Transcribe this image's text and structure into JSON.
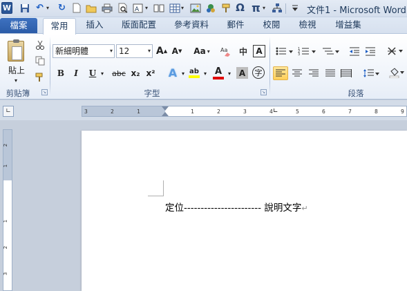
{
  "window": {
    "title": "文件1 - Microsoft Word"
  },
  "quick_access": {
    "icons": [
      "word-logo-icon",
      "save-icon",
      "undo-icon",
      "redo-icon",
      "new-document-icon",
      "open-icon",
      "print-icon",
      "print-preview-icon",
      "text-box-icon",
      "insert-page-icon",
      "table-icon",
      "picture-icon",
      "clip-art-icon",
      "format-painter-icon",
      "symbol-icon",
      "equation-icon",
      "smartart-icon",
      "customize-icon"
    ],
    "word_logo": "W",
    "symbol": "Ω",
    "equation": "π"
  },
  "tabs": [
    {
      "label": "檔案"
    },
    {
      "label": "常用"
    },
    {
      "label": "插入"
    },
    {
      "label": "版面配置"
    },
    {
      "label": "參考資料"
    },
    {
      "label": "郵件"
    },
    {
      "label": "校閱"
    },
    {
      "label": "檢視"
    },
    {
      "label": "增益集"
    }
  ],
  "ribbon": {
    "clipboard": {
      "paste_label": "貼上",
      "group_label": "剪貼簿"
    },
    "font": {
      "font_name": "新細明體",
      "font_size": "12",
      "group_label": "字型",
      "grow_label": "A",
      "shrink_label": "A",
      "case_label": "Aa",
      "bold": "B",
      "italic": "I",
      "underline": "U",
      "strike": "abc",
      "subscript": "x₂",
      "superscript": "x²",
      "text_effects": "A",
      "highlight": "ab",
      "font_color": "A",
      "char_shading": "A",
      "enclose": "字",
      "phonetic": "中",
      "border": "A"
    },
    "paragraph": {
      "group_label": "段落"
    }
  },
  "document": {
    "line_text": "定位----------------------- 說明文字",
    "para_mark": "↵"
  },
  "ruler": {
    "h_numbers": [
      "3",
      "2",
      "1",
      "1",
      "2",
      "3",
      "4",
      "5",
      "6",
      "7",
      "8",
      "9"
    ],
    "v_numbers": [
      "2",
      "1",
      "1",
      "2",
      "3"
    ]
  },
  "colors": {
    "file_tab": "#2a5aa6",
    "highlight": "#ffff00",
    "font_color": "#e00000"
  }
}
